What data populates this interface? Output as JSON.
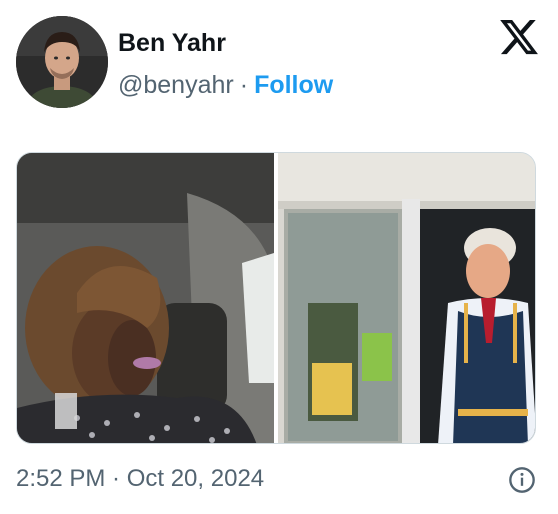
{
  "author": {
    "display_name": "Ben Yahr",
    "handle": "@benyahr",
    "separator": "·",
    "follow_label": "Follow",
    "avatar_icon": "person-portrait"
  },
  "brand_icon": "x-logo-icon",
  "media": {
    "photo_count": 2,
    "photos": [
      {
        "icon": "person-in-car-photo"
      },
      {
        "icon": "drive-thru-window-photo"
      }
    ]
  },
  "footer": {
    "timestamp": "2:52 PM · Oct 20, 2024",
    "info_icon": "info-icon"
  },
  "colors": {
    "text_primary": "#0f1419",
    "text_secondary": "#536471",
    "accent_blue": "#1d9bf0",
    "border": "#cfd9de"
  }
}
